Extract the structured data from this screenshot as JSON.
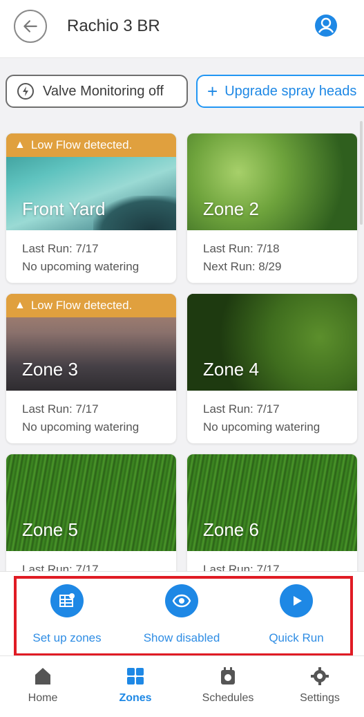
{
  "header": {
    "title": "Rachio 3 BR",
    "back_icon": "arrow-left-icon",
    "profile_icon": "user-circle-icon"
  },
  "chips": {
    "valve": "Valve Monitoring off",
    "upgrade": "Upgrade spray heads"
  },
  "zones": [
    {
      "name": "Front Yard",
      "alert": "Low Flow detected.",
      "line1": "Last Run: 7/17",
      "line2": "No upcoming watering"
    },
    {
      "name": "Zone 2",
      "alert": "",
      "line1": "Last Run: 7/18",
      "line2": "Next Run: 8/29"
    },
    {
      "name": "Zone 3",
      "alert": "Low Flow detected.",
      "line1": "Last Run: 7/17",
      "line2": "No upcoming watering"
    },
    {
      "name": "Zone 4",
      "alert": "",
      "line1": "Last Run: 7/17",
      "line2": "No upcoming watering"
    },
    {
      "name": "Zone 5",
      "alert": "",
      "line1": "Last Run: 7/17",
      "line2": ""
    },
    {
      "name": "Zone 6",
      "alert": "",
      "line1": "Last Run: 7/17",
      "line2": ""
    }
  ],
  "actions": {
    "setup": "Set up zones",
    "show_disabled": "Show disabled",
    "quick_run": "Quick Run"
  },
  "nav": {
    "home": "Home",
    "zones": "Zones",
    "schedules": "Schedules",
    "settings": "Settings",
    "active": "Zones"
  },
  "colors": {
    "accent": "#1e88e5",
    "alert": "#e0a03e",
    "highlight_box": "#e01b24"
  }
}
